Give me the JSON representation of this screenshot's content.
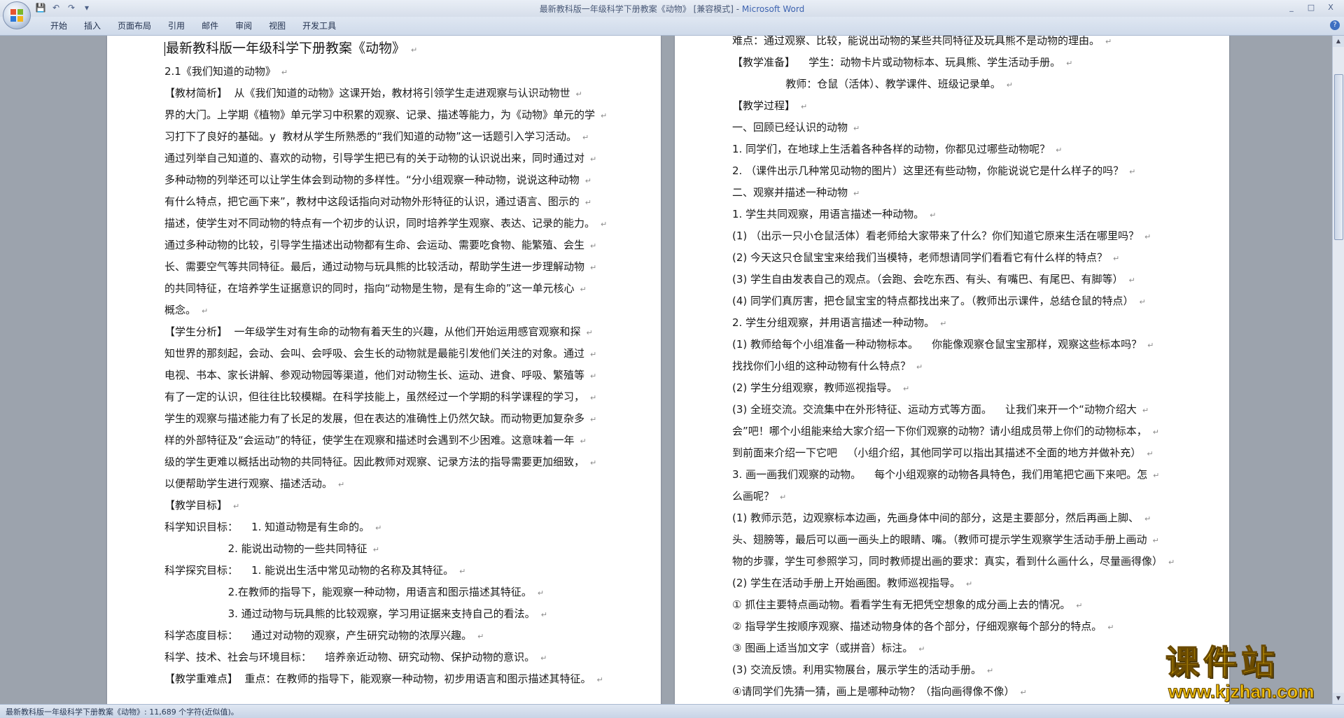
{
  "window": {
    "title": "最新教科版一年级科学下册教案《动物》 [兼容模式] - ",
    "app_name": "Microsoft Word",
    "controls": [
      "_",
      "□",
      "X"
    ]
  },
  "ribbon": {
    "tabs": [
      "开始",
      "插入",
      "页面布局",
      "引用",
      "邮件",
      "审阅",
      "视图",
      "开发工具"
    ],
    "help_label": "?"
  },
  "document": {
    "left_page": [
      "最新教科版一年级科学下册教案《动物》",
      "2.1《我们知道的动物》",
      "【教材简析】  从《我们知道的动物》这课开始，教材将引领学生走进观察与认识动物世",
      "界的大门。上学期《植物》单元学习中积累的观察、记录、描述等能力，为《动物》单元的学",
      "习打下了良好的基础。y  教材从学生所熟悉的“我们知道的动物”这一话题引入学习活动。",
      "通过列举自己知道的、喜欢的动物，引导学生把已有的关于动物的认识说出来，同时通过对",
      "多种动物的列举还可以让学生体会到动物的多样性。“分小组观察一种动物，说说这种动物",
      "有什么特点，把它画下来”，教材中这段话指向对动物外形特征的认识，通过语言、图示的",
      "描述，使学生对不同动物的特点有一个初步的认识，同时培养学生观察、表达、记录的能力。",
      "通过多种动物的比较，引导学生描述出动物都有生命、会运动、需要吃食物、能繁殖、会生",
      "长、需要空气等共同特征。最后，通过动物与玩具熊的比较活动，帮助学生进一步理解动物",
      "的共同特征，在培养学生证据意识的同时，指向“动物是生物，是有生命的”这一单元核心",
      "概念。",
      "【学生分析】  一年级学生对有生命的动物有着天生的兴趣，从他们开始运用感官观察和探",
      "知世界的那刻起，会动、会叫、会呼吸、会生长的动物就是最能引发他们关注的对象。通过",
      "电视、书本、家长讲解、参观动物园等渠道，他们对动物生长、运动、进食、呼吸、繁殖等",
      "有了一定的认识，但往往比较模糊。在科学技能上，虽然经过一个学期的科学课程的学习，",
      "学生的观察与描述能力有了长足的发展，但在表达的准确性上仍然欠缺。而动物更加复杂多",
      "样的外部特征及“会运动”的特征，使学生在观察和描述时会遇到不少困难。这意味着一年",
      "级的学生更难以概括出动物的共同特征。因此教师对观察、记录方法的指导需要更加细致，",
      "以便帮助学生进行观察、描述活动。",
      "【教学目标】",
      "科学知识目标：    1. 知道动物是有生命的。",
      "                   2. 能说出动物的一些共同特征",
      "科学探究目标：    1. 能说出生活中常见动物的名称及其特征。",
      "                   2.在教师的指导下，能观察一种动物，用语言和图示描述其特征。",
      "                   3. 通过动物与玩具熊的比较观察，学习用证据来支持自己的看法。",
      "科学态度目标：    通过对动物的观察，产生研究动物的浓厚兴趣。",
      "科学、技术、社会与环境目标：    培养亲近动物、研究动物、保护动物的意识。",
      "【教学重难点】  重点：在教师的指导下，能观察一种动物，初步用语言和图示描述其特征。"
    ],
    "right_page": [
      "难点：通过观察、比较，能说出动物的某些共同特征及玩具熊不是动物的理由。",
      "【教学准备】    学生：动物卡片或动物标本、玩具熊、学生活动手册。",
      "                教师：仓鼠（活体）、教学课件、班级记录单。",
      "【教学过程】",
      "一、回顾已经认识的动物",
      "1. 同学们，在地球上生活着各种各样的动物，你都见过哪些动物呢？",
      "2. （课件出示几种常见动物的图片）这里还有些动物，你能说说它是什么样子的吗？",
      "二、观察并描述一种动物",
      "1. 学生共同观察，用语言描述一种动物。",
      "(1) （出示一只小仓鼠活体）看老师给大家带来了什么？你们知道它原来生活在哪里吗？",
      "(2) 今天这只仓鼠宝宝来给我们当模特，老师想请同学们看看它有什么样的特点？",
      "(3) 学生自由发表自己的观点。（会跑、会吃东西、有头、有嘴巴、有尾巴、有脚等）",
      "(4) 同学们真厉害，把仓鼠宝宝的特点都找出来了。（教师出示课件，总结仓鼠的特点）",
      "2. 学生分组观察，并用语言描述一种动物。",
      "(1) 教师给每个小组准备一种动物标本。    你能像观察仓鼠宝宝那样，观察这些标本吗？",
      "找找你们小组的这种动物有什么特点？",
      "(2) 学生分组观察，教师巡视指导。",
      "(3) 全班交流。交流集中在外形特征、运动方式等方面。    让我们来开一个“动物介绍大",
      "会”吧！哪个小组能来给大家介绍一下你们观察的动物？请小组成员带上你们的动物标本，",
      "到前面来介绍一下它吧   （小组介绍，其他同学可以指出其描述不全面的地方并做补充）",
      "3. 画一画我们观察的动物。    每个小组观察的动物各具特色，我们用笔把它画下来吧。怎",
      "么画呢？",
      "(1) 教师示范，边观察标本边画，先画身体中间的部分，这是主要部分，然后再画上脚、",
      "头、翅膀等，最后可以画一画头上的眼睛、嘴。（教师可提示学生观察学生活动手册上画动",
      "物的步骤，学生可参照学习，同时教师提出画的要求：真实，看到什么画什么，尽量画得像）",
      "(2) 学生在活动手册上开始画图。教师巡视指导。",
      "① 抓住主要特点画动物。看看学生有无把凭空想象的成分画上去的情况。",
      "② 指导学生按顺序观察、描述动物身体的各个部分，仔细观察每个部分的特点。",
      "③ 图画上适当加文字（或拼音）标注。",
      "(3) 交流反馈。利用实物展台，展示学生的活动手册。",
      "④请同学们先猜一猜，画上是哪种动物？（指向画得像不像）"
    ]
  },
  "status": {
    "text": "最新教科版一年级科学下册教案《动物》: 11,689 个字符(近似值)。"
  },
  "watermark": {
    "cn": "课件站",
    "url": "www.kjzhan.com"
  }
}
